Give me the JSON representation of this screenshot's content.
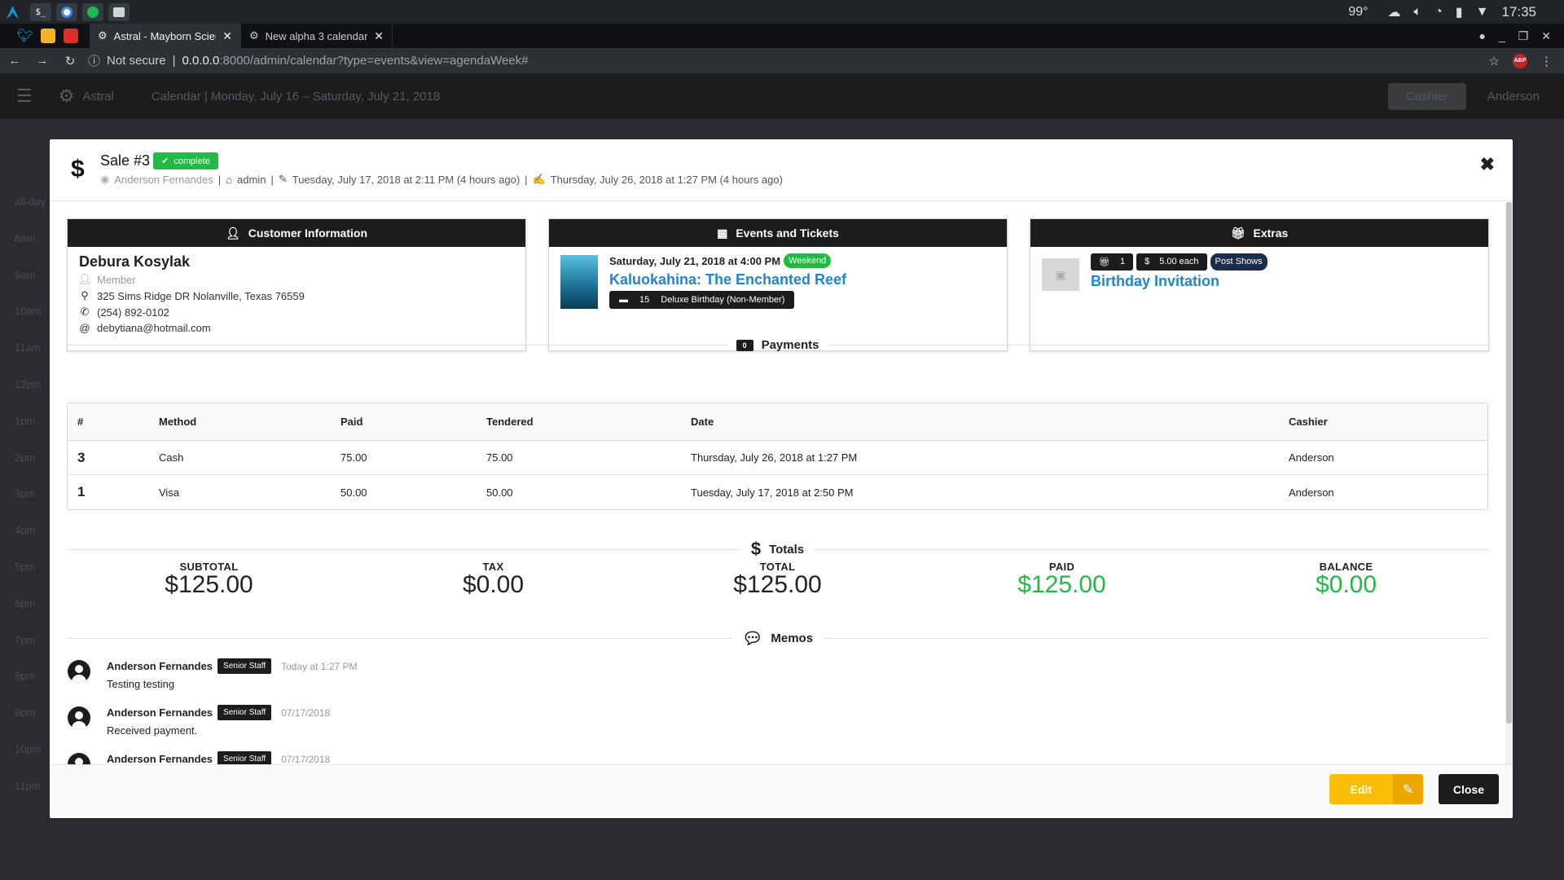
{
  "os": {
    "temperature": "99°",
    "clock": "17:35"
  },
  "browser": {
    "tabs": [
      {
        "title": "Astral - Mayborn Scien"
      },
      {
        "title": "New alpha 3 calendar"
      }
    ],
    "security": "Not secure",
    "url_host": "0.0.0.0",
    "url_path": ":8000/admin/calendar?type=events&view=agendaWeek#",
    "abp_label": "ABP"
  },
  "app": {
    "brand": "Astral",
    "breadcrumb": "Calendar | Monday, July 16 – Saturday, July 21, 2018",
    "cashier_button": "Cashier",
    "user": "Anderson",
    "hours": [
      "all-day",
      "8am",
      "9am",
      "10am",
      "11am",
      "12pm",
      "1pm",
      "2pm",
      "3pm",
      "4pm",
      "5pm",
      "6pm",
      "7pm",
      "8pm",
      "9pm",
      "10pm",
      "11pm"
    ]
  },
  "sale": {
    "title": "Sale #3",
    "status": "complete",
    "seller": "Anderson Fernandes",
    "register": "admin",
    "created": "Tuesday, July 17, 2018 at 2:11 PM (4 hours ago)",
    "updated": "Thursday, July 26, 2018 at 1:27 PM (4 hours ago)"
  },
  "customer": {
    "header": "Customer Information",
    "name": "Debura Kosylak",
    "membership": "Member",
    "address": "325 Sims Ridge DR Nolanville, Texas 76559",
    "phone": "(254) 892-0102",
    "email": "debytiana@hotmail.com"
  },
  "events": {
    "header": "Events and Tickets",
    "date": "Saturday, July 21, 2018 at 4:00 PM",
    "tag": "Weekend",
    "name": "Kaluokahina: The Enchanted Reef",
    "ticket_qty": "15",
    "ticket_type": "Deluxe Birthday (Non-Member)"
  },
  "extras": {
    "header": "Extras",
    "qty": "1",
    "price": "5.00 each",
    "tag": "Post Shows",
    "name": "Birthday Invitation"
  },
  "payments": {
    "header": "Payments",
    "columns": [
      "#",
      "Method",
      "Paid",
      "Tendered",
      "Date",
      "Cashier"
    ],
    "rows": [
      {
        "id": "3",
        "method": "Cash",
        "paid": "75.00",
        "tendered": "75.00",
        "date": "Thursday, July 26, 2018 at 1:27 PM",
        "cashier": "Anderson"
      },
      {
        "id": "1",
        "method": "Visa",
        "paid": "50.00",
        "tendered": "50.00",
        "date": "Tuesday, July 17, 2018 at 2:50 PM",
        "cashier": "Anderson"
      }
    ]
  },
  "totals": {
    "header": "Totals",
    "items": [
      {
        "label": "SUBTOTAL",
        "value": "$125.00"
      },
      {
        "label": "TAX",
        "value": "$0.00"
      },
      {
        "label": "TOTAL",
        "value": "$125.00"
      },
      {
        "label": "PAID",
        "value": "$125.00"
      },
      {
        "label": "BALANCE",
        "value": "$0.00"
      }
    ]
  },
  "memos": {
    "header": "Memos",
    "items": [
      {
        "author": "Anderson Fernandes",
        "role": "Senior Staff",
        "time": "Today at 1:27 PM",
        "text": "Testing testing"
      },
      {
        "author": "Anderson Fernandes",
        "role": "Senior Staff",
        "time": "07/17/2018",
        "text": "Received payment."
      },
      {
        "author": "Anderson Fernandes",
        "role": "Senior Staff",
        "time": "07/17/2018",
        "text": ""
      }
    ]
  },
  "footer": {
    "edit_label": "Edit",
    "close_label": "Close"
  },
  "colors": {
    "positive": "#21ba45",
    "link": "#2185d0",
    "edit": "#fbbd08"
  }
}
